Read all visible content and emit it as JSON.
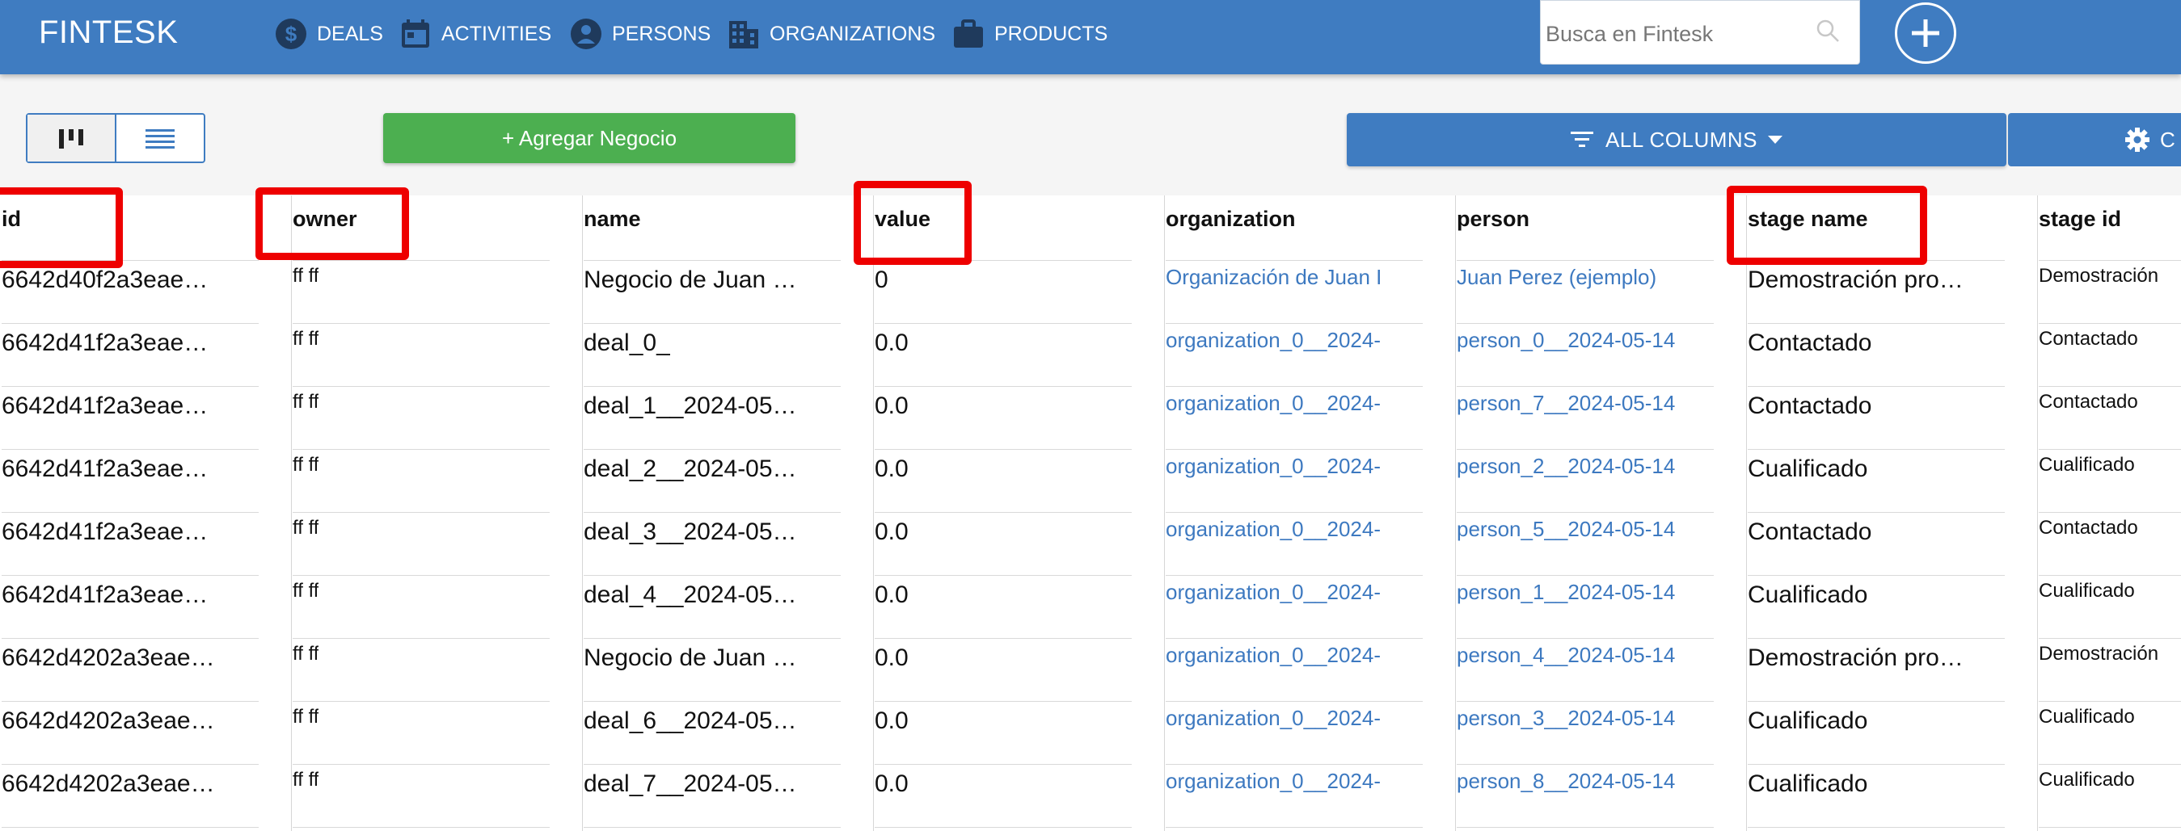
{
  "navbar": {
    "brand": "FINTESK",
    "items": [
      {
        "label": "DEALS",
        "icon": "dollar-icon"
      },
      {
        "label": "ACTIVITIES",
        "icon": "calendar-icon"
      },
      {
        "label": "PERSONS",
        "icon": "person-icon"
      },
      {
        "label": "ORGANIZATIONS",
        "icon": "building-icon"
      },
      {
        "label": "PRODUCTS",
        "icon": "briefcase-icon"
      }
    ],
    "search_placeholder": "Busca en Fintesk",
    "search_icon": "search-icon",
    "add_icon": "plus-circle-icon",
    "color": "#3f7cc1"
  },
  "toolbar": {
    "add_deal_label": "+ Agregar Negocio",
    "all_columns_label": "ALL COLUMNS",
    "config_label": "C",
    "add_deal_color": "#4caf50"
  },
  "table": {
    "columns": [
      "id",
      "owner",
      "name",
      "value",
      "organization",
      "person",
      "stage name",
      "stage id"
    ],
    "rows": [
      {
        "id": "6642d40f2a3eae…",
        "owner": "ff ff",
        "name": "Negocio de Juan …",
        "value": "0",
        "organization": "Organización de Juan I",
        "person": "Juan Perez (ejemplo)",
        "stage_name": "Demostración pro…",
        "stage_id": "Demostración"
      },
      {
        "id": "6642d41f2a3eae…",
        "owner": "ff ff",
        "name": "deal_0_",
        "value": "0.0",
        "organization": "organization_0__2024-",
        "person": "person_0__2024-05-14",
        "stage_name": "Contactado",
        "stage_id": "Contactado"
      },
      {
        "id": "6642d41f2a3eae…",
        "owner": "ff ff",
        "name": "deal_1__2024-05…",
        "value": "0.0",
        "organization": "organization_0__2024-",
        "person": "person_7__2024-05-14",
        "stage_name": "Contactado",
        "stage_id": "Contactado"
      },
      {
        "id": "6642d41f2a3eae…",
        "owner": "ff ff",
        "name": "deal_2__2024-05…",
        "value": "0.0",
        "organization": "organization_0__2024-",
        "person": "person_2__2024-05-14",
        "stage_name": "Cualificado",
        "stage_id": "Cualificado"
      },
      {
        "id": "6642d41f2a3eae…",
        "owner": "ff ff",
        "name": "deal_3__2024-05…",
        "value": "0.0",
        "organization": "organization_0__2024-",
        "person": "person_5__2024-05-14",
        "stage_name": "Contactado",
        "stage_id": "Contactado"
      },
      {
        "id": "6642d41f2a3eae…",
        "owner": "ff ff",
        "name": "deal_4__2024-05…",
        "value": "0.0",
        "organization": "organization_0__2024-",
        "person": "person_1__2024-05-14",
        "stage_name": "Cualificado",
        "stage_id": "Cualificado"
      },
      {
        "id": "6642d4202a3eae…",
        "owner": "ff ff",
        "name": "Negocio de Juan …",
        "value": "0.0",
        "organization": "organization_0__2024-",
        "person": "person_4__2024-05-14",
        "stage_name": "Demostración pro…",
        "stage_id": "Demostración"
      },
      {
        "id": "6642d4202a3eae…",
        "owner": "ff ff",
        "name": "deal_6__2024-05…",
        "value": "0.0",
        "organization": "organization_0__2024-",
        "person": "person_3__2024-05-14",
        "stage_name": "Cualificado",
        "stage_id": "Cualificado"
      },
      {
        "id": "6642d4202a3eae…",
        "owner": "ff ff",
        "name": "deal_7__2024-05…",
        "value": "0.0",
        "organization": "organization_0__2024-",
        "person": "person_8__2024-05-14",
        "stage_name": "Cualificado",
        "stage_id": "Cualificado"
      }
    ],
    "highlighted_columns": [
      "id",
      "owner",
      "value",
      "stage name"
    ],
    "highlight_color": "#ee0000",
    "link_color": "#3d79c0"
  }
}
